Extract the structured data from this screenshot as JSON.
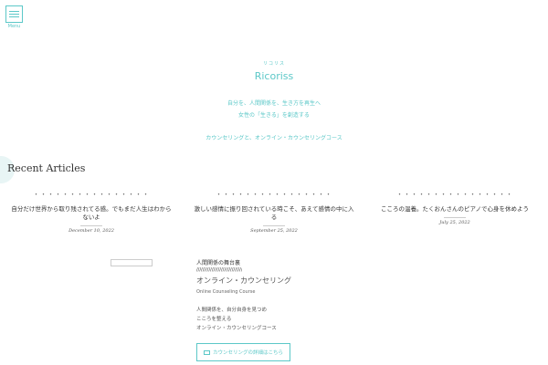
{
  "header": {
    "menu_label": "Menu"
  },
  "hero": {
    "kana": "リコリス",
    "title": "Ricoriss",
    "tagline_1": "自分を、人間関係を、生き方を再生へ",
    "tagline_2": "女性の「生きる」を創造する",
    "tagline_3": "カウンセリングと、オンライン・カウンセリングコース"
  },
  "recent": {
    "title": "Recent Articles",
    "articles": [
      {
        "clipped": "・・・・・・・・・・・・・・・・",
        "title": "自分だけ世界から取り残されてる感。でもまだ人生はわからないよ",
        "date": "December 10, 2022"
      },
      {
        "clipped": "・・・・・・・・・・・・・・・・",
        "title": "激しい感情に振り回されている時こそ、あえて感情の中に入る",
        "date": "September 25, 2022"
      },
      {
        "clipped": "・・・・・・・・・・・・・・・・",
        "title": "こころの温養。たくおんさんのピアノで心身を休めよう",
        "date": "July 25, 2022"
      }
    ]
  },
  "promo": {
    "label": "人間関係の舞台裏",
    "deco": "////////////////////////////////////",
    "title": "オンライン・カウンセリング",
    "subtitle": "Online Counseling Course",
    "line_1": "人間関係を、自分自身を見つめ",
    "line_2": "こころを整える",
    "line_3": "オンライン・カウンセリングコース",
    "cta": "カウンセリングの詳細はこちら"
  }
}
